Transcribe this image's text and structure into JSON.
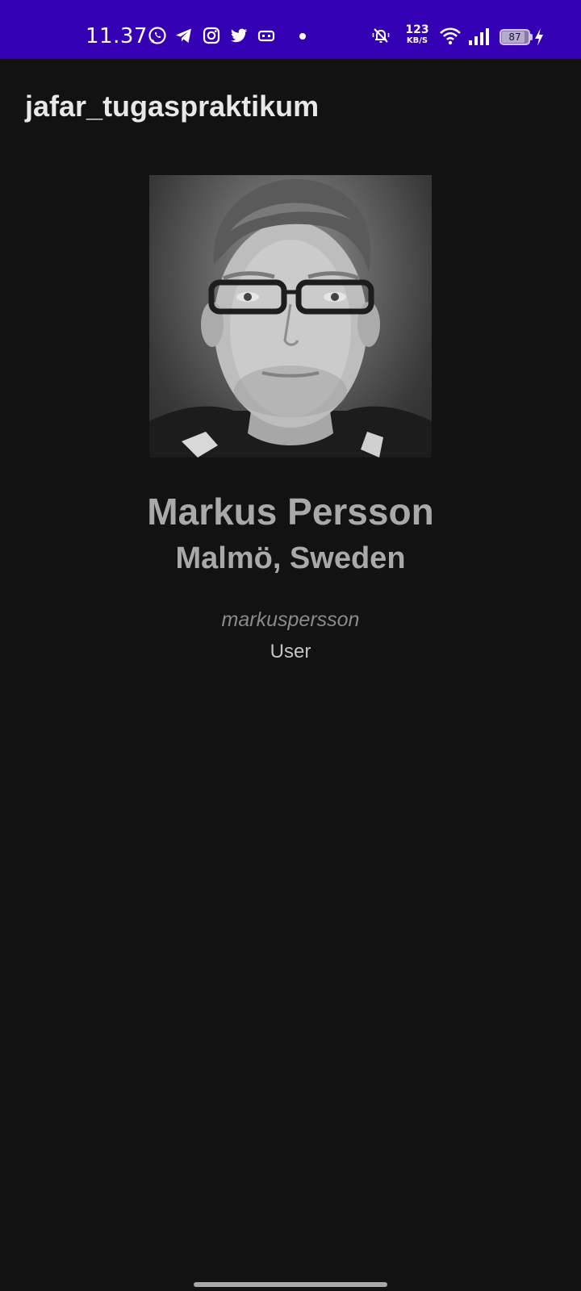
{
  "status_bar": {
    "time": "11.37",
    "left_icons": [
      "whatsapp-icon",
      "telegram-icon",
      "instagram-icon",
      "twitter-icon",
      "game-controller-icon",
      "dot-icon"
    ],
    "net_speed_value": "123",
    "net_speed_unit": "KB/S",
    "battery_level": "87",
    "battery_percent": 87,
    "colors": {
      "background": "#3500b3",
      "foreground": "#ffffff"
    }
  },
  "app_bar": {
    "title": "jafar_tugaspraktikum"
  },
  "profile": {
    "name": "Markus Persson",
    "location": "Malmö, Sweden",
    "username": "markuspersson",
    "role": "User",
    "photo": "profile-photo"
  },
  "colors": {
    "background": "#121212",
    "title_text": "#e8e8e8",
    "name_text": "#a9a9a9",
    "username_text": "#8a8a8a",
    "role_text": "#c4c4c4"
  }
}
